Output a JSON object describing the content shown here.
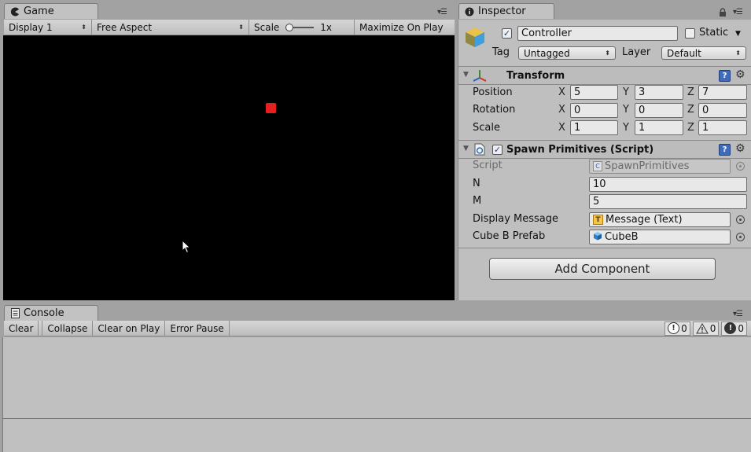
{
  "game": {
    "tab_label": "Game",
    "display_label": "Display 1",
    "aspect_label": "Free Aspect",
    "scale_label": "Scale",
    "scale_value": "1x",
    "maximize_label": "Maximize On Play"
  },
  "inspector": {
    "tab_label": "Inspector",
    "object_name": "Controller",
    "static_label": "Static",
    "tag_label": "Tag",
    "tag_value": "Untagged",
    "layer_label": "Layer",
    "layer_value": "Default",
    "transform": {
      "title": "Transform",
      "position_label": "Position",
      "rotation_label": "Rotation",
      "scale_label": "Scale",
      "axis_x": "X",
      "axis_y": "Y",
      "axis_z": "Z",
      "position": {
        "x": "5",
        "y": "3",
        "z": "7"
      },
      "rotation": {
        "x": "0",
        "y": "0",
        "z": "0"
      },
      "scale": {
        "x": "1",
        "y": "1",
        "z": "1"
      }
    },
    "script_component": {
      "title": "Spawn Primitives (Script)",
      "script_label": "Script",
      "script_value": "SpawnPrimitives",
      "n_label": "N",
      "n_value": "10",
      "m_label": "M",
      "m_value": "5",
      "display_message_label": "Display Message",
      "display_message_value": "Message (Text)",
      "cube_prefab_label": "Cube B Prefab",
      "cube_prefab_value": "CubeB"
    },
    "add_component_label": "Add Component"
  },
  "console": {
    "tab_label": "Console",
    "clear_label": "Clear",
    "collapse_label": "Collapse",
    "clear_on_play_label": "Clear on Play",
    "error_pause_label": "Error Pause",
    "info_count": "0",
    "warning_count": "0",
    "error_count": "0"
  },
  "colors": {
    "game_view_bg": "#000000",
    "spawned_cube": "#e62020",
    "checkbox_accent": "#1d3f8f"
  }
}
